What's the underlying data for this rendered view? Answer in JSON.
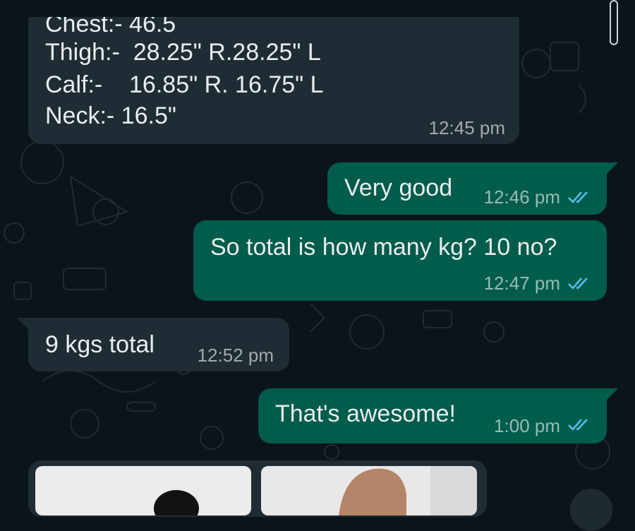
{
  "measurements_message": {
    "lines": [
      "Chest:- 46.5",
      "Thigh:-  28.25\" R.28.25\" L",
      "Calf:-    16.85\" R. 16.75\" L",
      "Neck:- 16.5\""
    ],
    "time": "12:45 pm"
  },
  "messages": [
    {
      "text": "Very good",
      "time": "12:46 pm",
      "status": "read"
    },
    {
      "text": "So total is how many kg? 10 no?",
      "time": "12:47 pm",
      "status": "read"
    },
    {
      "text": "9 kgs total",
      "time": "12:52 pm"
    },
    {
      "text": "That's awesome!",
      "time": "1:00 pm",
      "status": "read"
    }
  ],
  "colors": {
    "background": "#0b141a",
    "incoming_bubble": "#202c33",
    "outgoing_bubble": "#005c4b",
    "read_ticks": "#53bdeb"
  }
}
